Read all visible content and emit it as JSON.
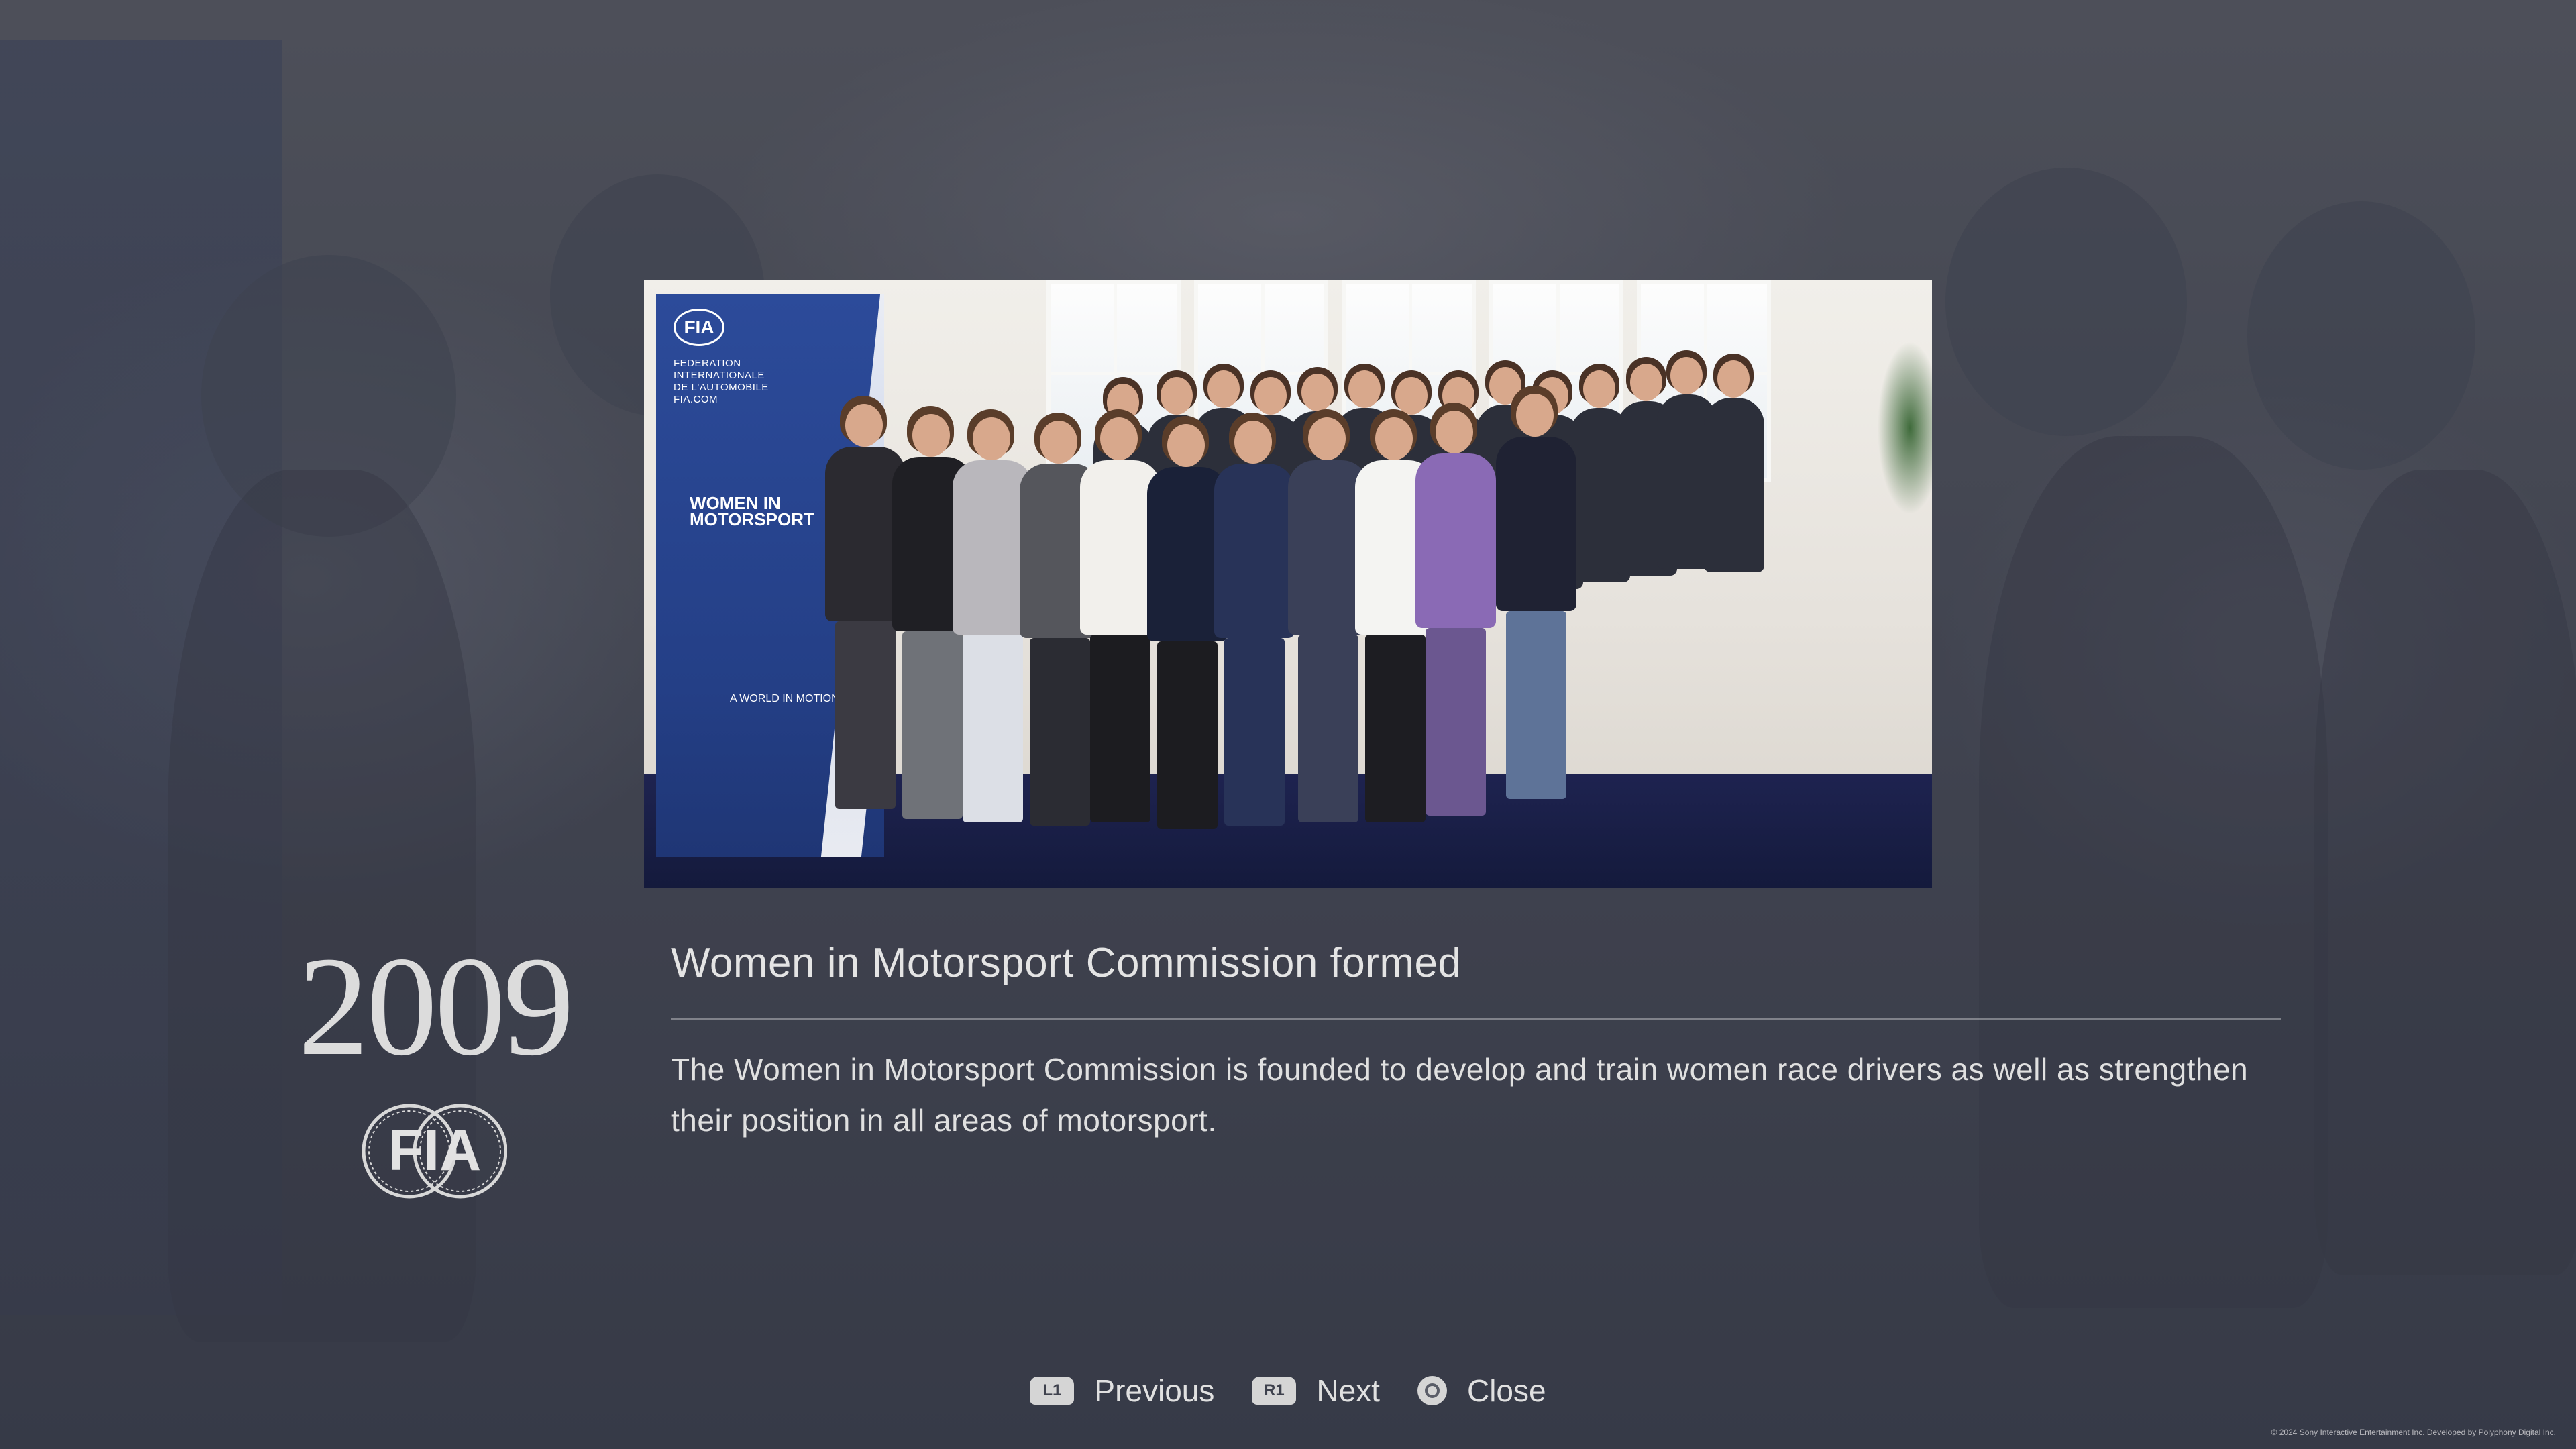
{
  "event": {
    "year": "2009",
    "title": "Women in Motorsport Commission formed",
    "description": "The Women in Motorsport Commission is founded to develop and train women race drivers as well as strengthen their position in all areas of motorsport.",
    "logo_text": "FIA"
  },
  "photo": {
    "banner_logo": "FIA",
    "banner_org_lines": [
      "FEDERATION",
      "INTERNATIONALE",
      "DE L'AUTOMOBILE",
      "FIA.COM"
    ],
    "banner_program": "WOMEN IN MOTORSPORT",
    "banner_tagline": "A WORLD IN MOTION"
  },
  "controls": {
    "previous": {
      "badge": "L1",
      "label": "Previous"
    },
    "next": {
      "badge": "R1",
      "label": "Next"
    },
    "close": {
      "label": "Close"
    }
  },
  "footer": {
    "copyright": "© 2024 Sony Interactive Entertainment Inc. Developed by Polyphony Digital Inc."
  }
}
